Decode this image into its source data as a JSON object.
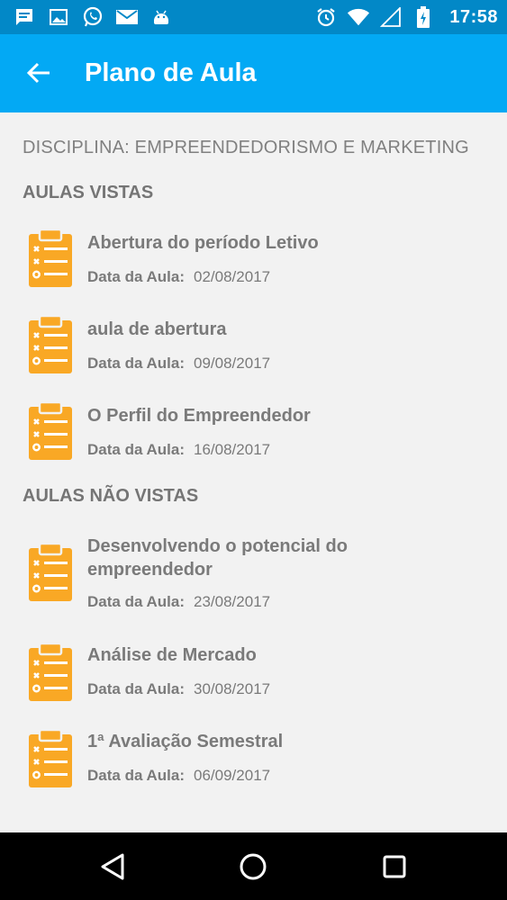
{
  "status_bar": {
    "time": "17:58",
    "left_icons": [
      "message-icon",
      "image-icon",
      "whatsapp-icon",
      "email-icon",
      "android-icon"
    ],
    "right_icons": [
      "alarm-icon",
      "wifi-icon",
      "signal-icon",
      "battery-icon"
    ]
  },
  "appbar": {
    "title": "Plano de Aula",
    "back_icon": "arrow-back-icon"
  },
  "discipline": "DISCIPLINA: EMPREENDEDORISMO E MARKETING",
  "sections": {
    "seen": {
      "header": "AULAS VISTAS",
      "lessons": [
        {
          "title": "Abertura do período Letivo",
          "date_label": "Data da Aula:",
          "date": "02/08/2017"
        },
        {
          "title": "aula de abertura",
          "date_label": "Data da Aula:",
          "date": "09/08/2017"
        },
        {
          "title": "O Perfil do Empreendedor",
          "date_label": "Data da Aula:",
          "date": "16/08/2017"
        }
      ]
    },
    "unseen": {
      "header": "AULAS NÃO VISTAS",
      "lessons": [
        {
          "title": "Desenvolvendo o potencial do empreendedor",
          "date_label": "Data da Aula:",
          "date": "23/08/2017"
        },
        {
          "title": "Análise de Mercado",
          "date_label": "Data da Aula:",
          "date": "30/08/2017"
        },
        {
          "title": "1ª Avaliação Semestral",
          "date_label": "Data da Aula:",
          "date": "06/09/2017"
        }
      ]
    }
  },
  "nav_bar": {
    "back": "nav-back-icon",
    "home": "nav-home-icon",
    "recents": "nav-recents-icon"
  },
  "colors": {
    "status_bar": "#0288c7",
    "app_bar": "#03a9f4",
    "icon": "#f9a825",
    "background": "#f2f2f2",
    "text": "#7a7a7a"
  }
}
